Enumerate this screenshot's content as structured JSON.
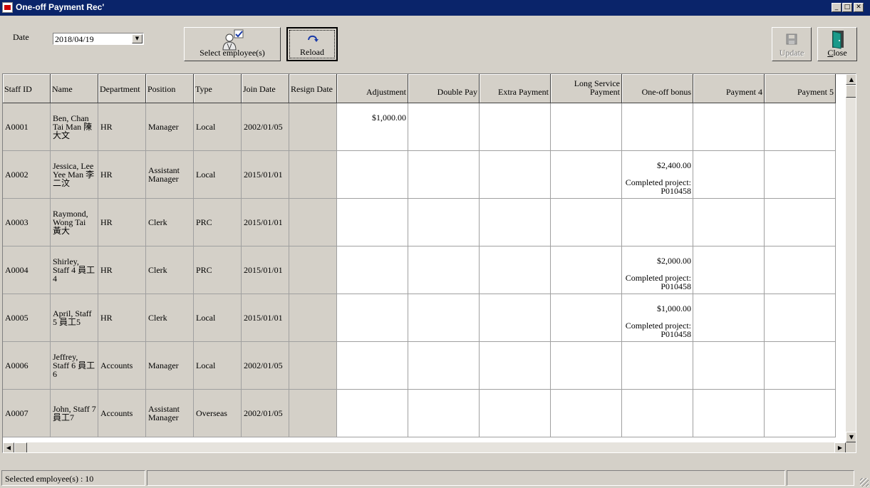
{
  "window": {
    "title": "One-off Payment Rec'",
    "controls": {
      "minimize": "_",
      "maximize": "□",
      "close": "✕"
    }
  },
  "toolbar": {
    "date_label": "Date",
    "date_value": "2018/04/19",
    "select_employee_label": "Select employee(s)",
    "reload_label": "Reload",
    "update_label": "Update",
    "close_label": "Close"
  },
  "grid": {
    "columns": [
      {
        "label": "Staff ID",
        "align": "left"
      },
      {
        "label": "Name",
        "align": "left"
      },
      {
        "label": "Department",
        "align": "left"
      },
      {
        "label": "Position",
        "align": "left"
      },
      {
        "label": "Type",
        "align": "left"
      },
      {
        "label": "Join Date",
        "align": "left"
      },
      {
        "label": "Resign Date",
        "align": "left"
      },
      {
        "label": "Adjustment",
        "align": "right"
      },
      {
        "label": "Double Pay",
        "align": "right"
      },
      {
        "label": "Extra Payment",
        "align": "right"
      },
      {
        "label": "Long Service Payment",
        "align": "right"
      },
      {
        "label": "One-off bonus",
        "align": "right"
      },
      {
        "label": "Payment 4",
        "align": "right"
      },
      {
        "label": "Payment 5",
        "align": "right"
      }
    ],
    "rows": [
      {
        "staff_id": "A0001",
        "name": "Ben, Chan Tai Man 陳大文",
        "department": "HR",
        "position": "Manager",
        "type": "Local",
        "join_date": "2002/01/05",
        "resign_date": "",
        "payments": [
          {
            "amount": "$1,000.00",
            "note": ""
          },
          {
            "amount": "",
            "note": ""
          },
          {
            "amount": "",
            "note": ""
          },
          {
            "amount": "",
            "note": ""
          },
          {
            "amount": "",
            "note": ""
          },
          {
            "amount": "",
            "note": ""
          },
          {
            "amount": "",
            "note": ""
          }
        ]
      },
      {
        "staff_id": "A0002",
        "name": "Jessica, Lee Yee Man 李二汶",
        "department": "HR",
        "position": "Assistant Manager",
        "type": "Local",
        "join_date": "2015/01/01",
        "resign_date": "",
        "payments": [
          {
            "amount": "",
            "note": ""
          },
          {
            "amount": "",
            "note": ""
          },
          {
            "amount": "",
            "note": ""
          },
          {
            "amount": "",
            "note": ""
          },
          {
            "amount": "$2,400.00",
            "note": "Completed project: P010458"
          },
          {
            "amount": "",
            "note": ""
          },
          {
            "amount": "",
            "note": ""
          }
        ]
      },
      {
        "staff_id": "A0003",
        "name": "Raymond, Wong Tai 黃大",
        "department": "HR",
        "position": "Clerk",
        "type": "PRC",
        "join_date": "2015/01/01",
        "resign_date": "",
        "payments": [
          {
            "amount": "",
            "note": ""
          },
          {
            "amount": "",
            "note": ""
          },
          {
            "amount": "",
            "note": ""
          },
          {
            "amount": "",
            "note": ""
          },
          {
            "amount": "",
            "note": ""
          },
          {
            "amount": "",
            "note": ""
          },
          {
            "amount": "",
            "note": ""
          }
        ]
      },
      {
        "staff_id": "A0004",
        "name": "Shirley, Staff 4 員工4",
        "department": "HR",
        "position": "Clerk",
        "type": "PRC",
        "join_date": "2015/01/01",
        "resign_date": "",
        "payments": [
          {
            "amount": "",
            "note": ""
          },
          {
            "amount": "",
            "note": ""
          },
          {
            "amount": "",
            "note": ""
          },
          {
            "amount": "",
            "note": ""
          },
          {
            "amount": "$2,000.00",
            "note": "Completed project: P010458"
          },
          {
            "amount": "",
            "note": ""
          },
          {
            "amount": "",
            "note": ""
          }
        ]
      },
      {
        "staff_id": "A0005",
        "name": "April, Staff 5 員工5",
        "department": "HR",
        "position": "Clerk",
        "type": "Local",
        "join_date": "2015/01/01",
        "resign_date": "",
        "payments": [
          {
            "amount": "",
            "note": ""
          },
          {
            "amount": "",
            "note": ""
          },
          {
            "amount": "",
            "note": ""
          },
          {
            "amount": "",
            "note": ""
          },
          {
            "amount": "$1,000.00",
            "note": "Completed project: P010458"
          },
          {
            "amount": "",
            "note": ""
          },
          {
            "amount": "",
            "note": ""
          }
        ]
      },
      {
        "staff_id": "A0006",
        "name": "Jeffrey, Staff 6 員工6",
        "department": "Accounts",
        "position": "Manager",
        "type": "Local",
        "join_date": "2002/01/05",
        "resign_date": "",
        "payments": [
          {
            "amount": "",
            "note": ""
          },
          {
            "amount": "",
            "note": ""
          },
          {
            "amount": "",
            "note": ""
          },
          {
            "amount": "",
            "note": ""
          },
          {
            "amount": "",
            "note": ""
          },
          {
            "amount": "",
            "note": ""
          },
          {
            "amount": "",
            "note": ""
          }
        ]
      },
      {
        "staff_id": "A0007",
        "name": "John, Staff 7 員工7",
        "department": "Accounts",
        "position": "Assistant Manager",
        "type": "Overseas",
        "join_date": "2002/01/05",
        "resign_date": "",
        "payments": [
          {
            "amount": "",
            "note": ""
          },
          {
            "amount": "",
            "note": ""
          },
          {
            "amount": "",
            "note": ""
          },
          {
            "amount": "",
            "note": ""
          },
          {
            "amount": "",
            "note": ""
          },
          {
            "amount": "",
            "note": ""
          },
          {
            "amount": "",
            "note": ""
          }
        ]
      }
    ]
  },
  "statusbar": {
    "selected_text": "Selected employee(s) : 10"
  },
  "icons": {
    "app": "app-icon",
    "select_employee": "employee-select-icon",
    "reload": "reload-icon",
    "update": "floppy-disk-icon",
    "close": "door-exit-icon"
  },
  "colors": {
    "titlebar": "#0a246a",
    "face": "#d4d0c8",
    "grid_bg": "#ffffff"
  }
}
